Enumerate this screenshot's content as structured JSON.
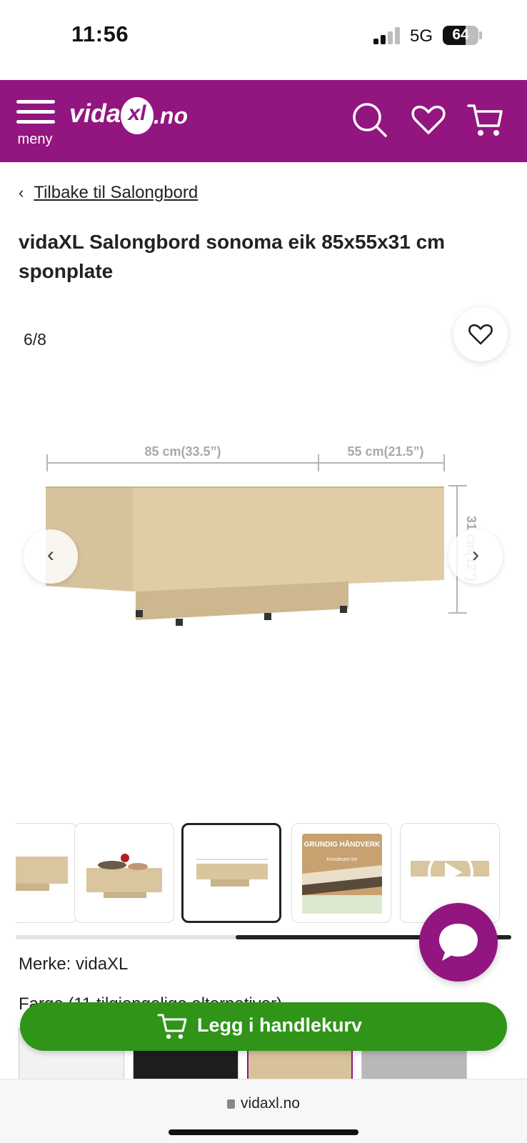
{
  "status_bar": {
    "time": "11:56",
    "network": "5G",
    "battery_percent": "64",
    "battery_level": 0.64
  },
  "header": {
    "menu_label": "meny",
    "logo_text_left": "vida",
    "logo_badge_text": "xl",
    "logo_text_right": ".no",
    "icons": [
      "menu-icon",
      "search-icon",
      "heart-icon",
      "cart-icon"
    ],
    "brand_color": "#93157f"
  },
  "breadcrumb": {
    "chevron": "‹",
    "label": "Tilbake til Salongbord"
  },
  "product": {
    "title": "vidaXL Salongbord sonoma eik 85x55x31 cm sponplate",
    "image_counter": "6/8",
    "dimensions": {
      "width_label": "85 cm(33.5”)",
      "depth_label": "55 cm(21.5”)",
      "height_label": "31 cm(12”)"
    },
    "brand_line": "Merke: vidaXL",
    "color_line": "Farge (11 tilgjengelige alternativer)"
  },
  "thumbnails": {
    "count": 5,
    "active_index": 2,
    "banner_title": "GRUNDIG HÅNDVERK",
    "banner_subtitle": "Konstruert tre",
    "scroll_position": 0.48
  },
  "swatch_colors": [
    "#f2f2f2",
    "#1e1e1e",
    "#d8c29a",
    "#b8b8b8"
  ],
  "cta": {
    "add_to_cart": "Legg i handlekurv",
    "color": "#2f9418"
  },
  "browser": {
    "url": "vidaxl.no"
  }
}
